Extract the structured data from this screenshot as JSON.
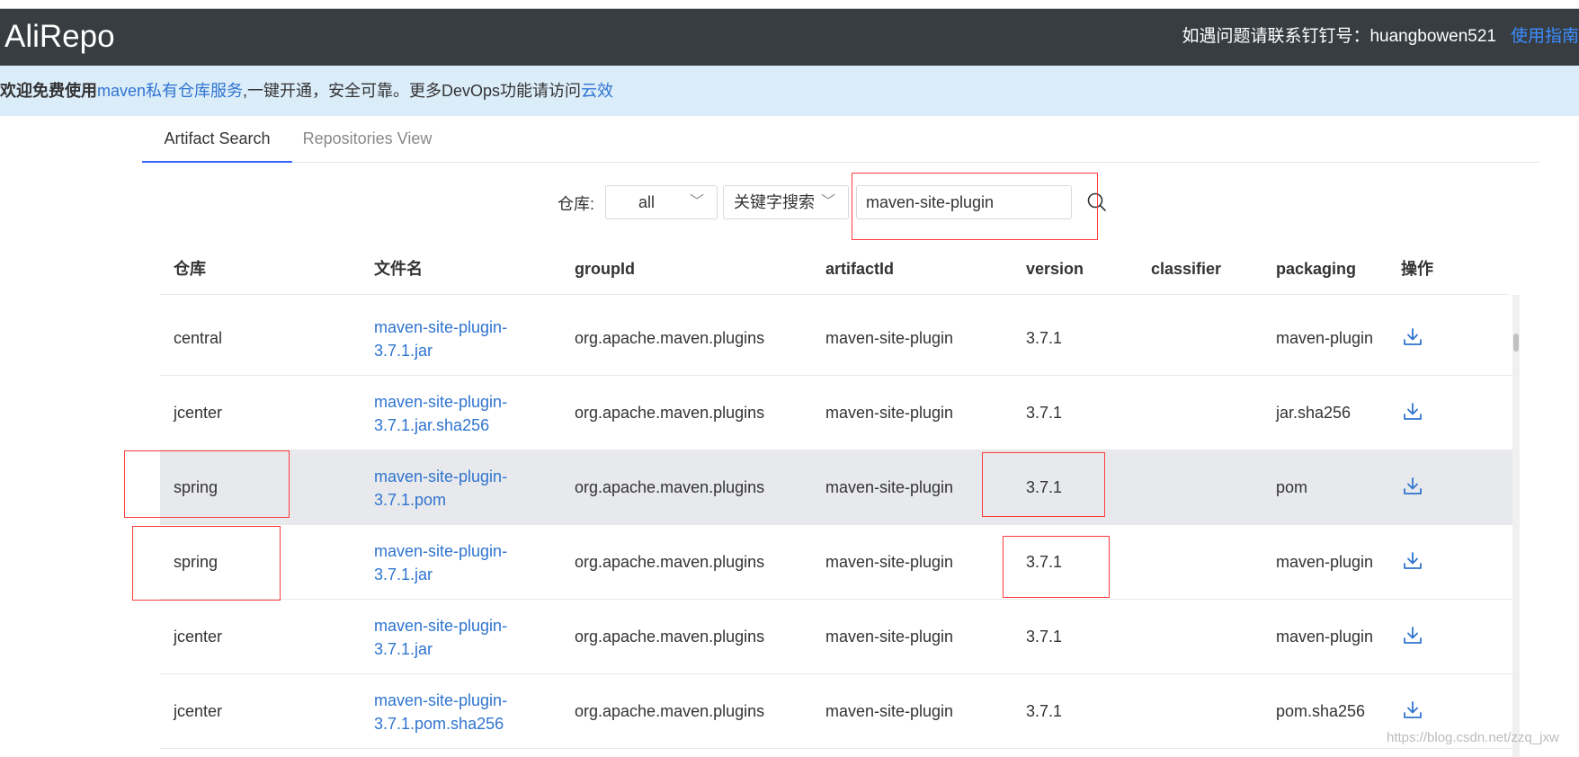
{
  "header": {
    "brand": "AliRepo",
    "contact_text": "如遇问题请联系钉钉号：huangbowen521",
    "guide_link": "使用指南"
  },
  "banner": {
    "bold_text": "欢迎免费使用",
    "link1": "maven私有仓库服务",
    "mid_text": ",一键开通，安全可靠。更多DevOps功能请访问",
    "link2": "云效"
  },
  "tabs": [
    {
      "label": "Artifact Search",
      "active": true
    },
    {
      "label": "Repositories View",
      "active": false
    }
  ],
  "search": {
    "repo_label": "仓库:",
    "repo_value": "all",
    "mode_value": "关键字搜索",
    "query": "maven-site-plugin"
  },
  "table": {
    "columns": [
      "仓库",
      "文件名",
      "groupId",
      "artifactId",
      "version",
      "classifier",
      "packaging",
      "操作"
    ],
    "rows": [
      {
        "repo": "central",
        "file_line1": "maven-site-plugin-",
        "file_line2": "3.7.1.jar",
        "groupId": "org.apache.maven.plugins",
        "artifactId": "maven-site-plugin",
        "version": "3.7.1",
        "classifier": "",
        "packaging": "maven-plugin"
      },
      {
        "repo": "jcenter",
        "file_line1": "maven-site-plugin-",
        "file_line2": "3.7.1.jar.sha256",
        "groupId": "org.apache.maven.plugins",
        "artifactId": "maven-site-plugin",
        "version": "3.7.1",
        "classifier": "",
        "packaging": "jar.sha256"
      },
      {
        "repo": "spring",
        "file_line1": "maven-site-plugin-",
        "file_line2": "3.7.1.pom",
        "groupId": "org.apache.maven.plugins",
        "artifactId": "maven-site-plugin",
        "version": "3.7.1",
        "classifier": "",
        "packaging": "pom"
      },
      {
        "repo": "spring",
        "file_line1": "maven-site-plugin-",
        "file_line2": "3.7.1.jar",
        "groupId": "org.apache.maven.plugins",
        "artifactId": "maven-site-plugin",
        "version": "3.7.1",
        "classifier": "",
        "packaging": "maven-plugin"
      },
      {
        "repo": "jcenter",
        "file_line1": "maven-site-plugin-",
        "file_line2": "3.7.1.jar",
        "groupId": "org.apache.maven.plugins",
        "artifactId": "maven-site-plugin",
        "version": "3.7.1",
        "classifier": "",
        "packaging": "maven-plugin"
      },
      {
        "repo": "jcenter",
        "file_line1": "maven-site-plugin-",
        "file_line2": "3.7.1.pom.sha256",
        "groupId": "org.apache.maven.plugins",
        "artifactId": "maven-site-plugin",
        "version": "3.7.1",
        "classifier": "",
        "packaging": "pom.sha256"
      }
    ]
  },
  "icons": {
    "download": "download-icon",
    "search": "search-icon",
    "dropdown": "chevron-down-icon"
  },
  "watermark": "https://blog.csdn.net/zzq_jxw",
  "colors": {
    "header_bg": "#373d41",
    "banner_bg": "#dcedfa",
    "link": "#2f74d0",
    "accent": "#3366ff",
    "annotation": "#ff3b3b"
  }
}
